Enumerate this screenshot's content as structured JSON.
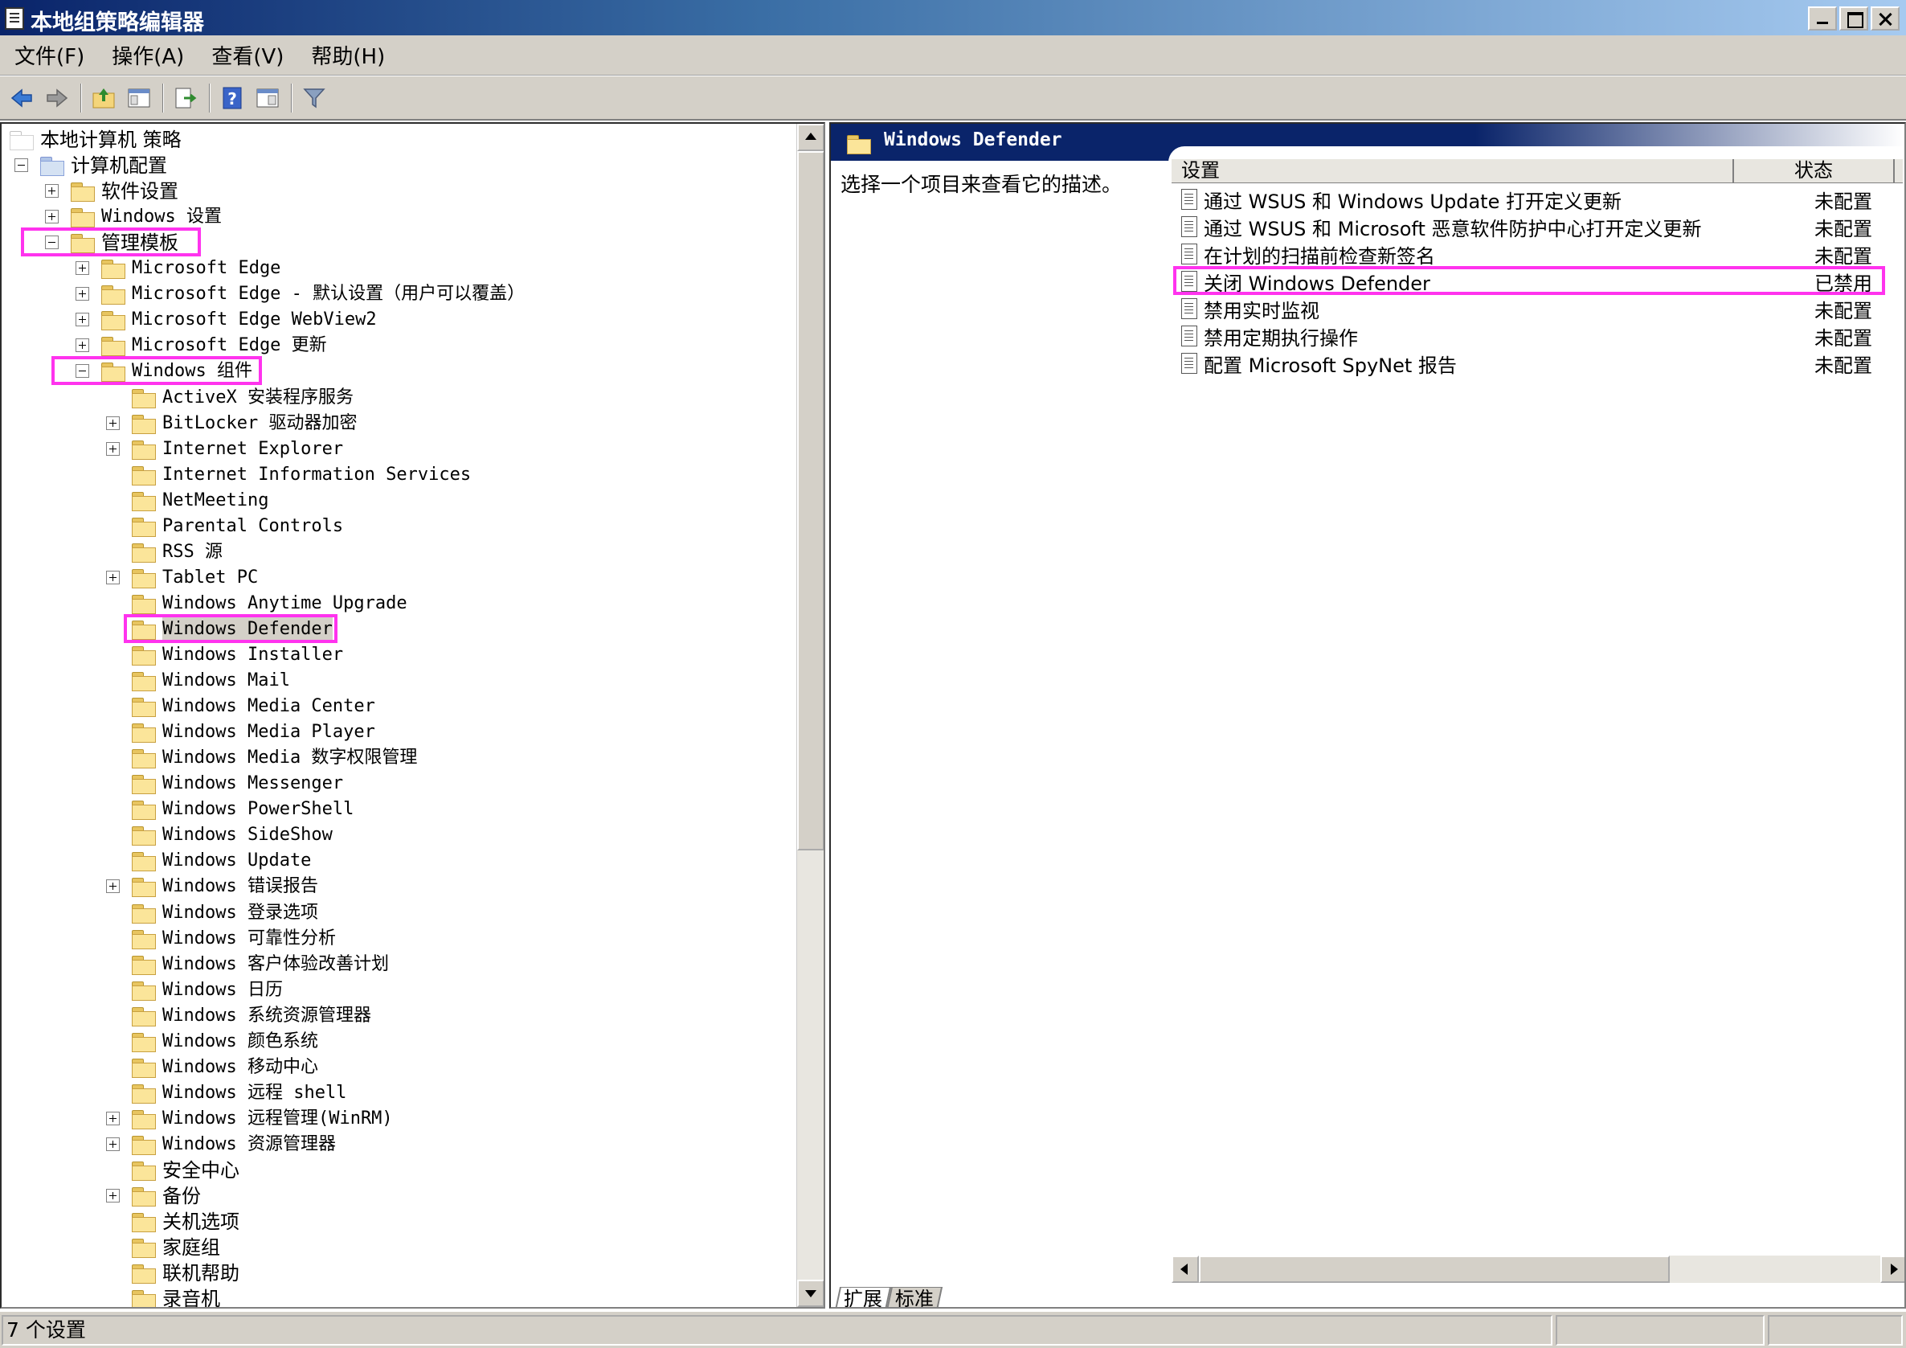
{
  "window": {
    "title": "本地组策略编辑器"
  },
  "menu": [
    "文件(F)",
    "操作(A)",
    "查看(V)",
    "帮助(H)"
  ],
  "toolbar": {
    "icons": [
      "back-arrow-icon",
      "forward-arrow-icon",
      "up-folder-icon",
      "show-hide-tree-icon",
      "export-list-icon",
      "help-icon",
      "properties-icon",
      "filter-icon"
    ]
  },
  "tree": [
    {
      "label": "本地计算机 策略",
      "level": 0,
      "expander": "none",
      "icon": "policy"
    },
    {
      "label": "计算机配置",
      "level": 1,
      "expander": "minus",
      "icon": "computer"
    },
    {
      "label": "软件设置",
      "level": 2,
      "expander": "plus",
      "icon": "folder"
    },
    {
      "label": "Windows 设置",
      "level": 2,
      "expander": "plus",
      "icon": "folder"
    },
    {
      "label": "管理模板",
      "level": 2,
      "expander": "minus",
      "icon": "folder"
    },
    {
      "label": "Microsoft Edge",
      "level": 3,
      "expander": "plus",
      "icon": "folder"
    },
    {
      "label": "Microsoft Edge - 默认设置（用户可以覆盖）",
      "level": 3,
      "expander": "plus",
      "icon": "folder"
    },
    {
      "label": "Microsoft Edge WebView2",
      "level": 3,
      "expander": "plus",
      "icon": "folder"
    },
    {
      "label": "Microsoft Edge 更新",
      "level": 3,
      "expander": "plus",
      "icon": "folder"
    },
    {
      "label": "Windows 组件",
      "level": 3,
      "expander": "minus",
      "icon": "folder"
    },
    {
      "label": "ActiveX 安装程序服务",
      "level": 4,
      "expander": "none",
      "icon": "folder"
    },
    {
      "label": "BitLocker 驱动器加密",
      "level": 4,
      "expander": "plus",
      "icon": "folder"
    },
    {
      "label": "Internet Explorer",
      "level": 4,
      "expander": "plus",
      "icon": "folder"
    },
    {
      "label": "Internet Information Services",
      "level": 4,
      "expander": "none",
      "icon": "folder"
    },
    {
      "label": "NetMeeting",
      "level": 4,
      "expander": "none",
      "icon": "folder"
    },
    {
      "label": "Parental Controls",
      "level": 4,
      "expander": "none",
      "icon": "folder"
    },
    {
      "label": "RSS 源",
      "level": 4,
      "expander": "none",
      "icon": "folder"
    },
    {
      "label": "Tablet PC",
      "level": 4,
      "expander": "plus",
      "icon": "folder"
    },
    {
      "label": "Windows Anytime Upgrade",
      "level": 4,
      "expander": "none",
      "icon": "folder"
    },
    {
      "label": "Windows Defender",
      "level": 4,
      "expander": "none",
      "icon": "folder",
      "selected": true
    },
    {
      "label": "Windows Installer",
      "level": 4,
      "expander": "none",
      "icon": "folder"
    },
    {
      "label": "Windows Mail",
      "level": 4,
      "expander": "none",
      "icon": "folder"
    },
    {
      "label": "Windows Media Center",
      "level": 4,
      "expander": "none",
      "icon": "folder"
    },
    {
      "label": "Windows Media Player",
      "level": 4,
      "expander": "none",
      "icon": "folder"
    },
    {
      "label": "Windows Media 数字权限管理",
      "level": 4,
      "expander": "none",
      "icon": "folder"
    },
    {
      "label": "Windows Messenger",
      "level": 4,
      "expander": "none",
      "icon": "folder"
    },
    {
      "label": "Windows PowerShell",
      "level": 4,
      "expander": "none",
      "icon": "folder"
    },
    {
      "label": "Windows SideShow",
      "level": 4,
      "expander": "none",
      "icon": "folder"
    },
    {
      "label": "Windows Update",
      "level": 4,
      "expander": "none",
      "icon": "folder"
    },
    {
      "label": "Windows 错误报告",
      "level": 4,
      "expander": "plus",
      "icon": "folder"
    },
    {
      "label": "Windows 登录选项",
      "level": 4,
      "expander": "none",
      "icon": "folder"
    },
    {
      "label": "Windows 可靠性分析",
      "level": 4,
      "expander": "none",
      "icon": "folder"
    },
    {
      "label": "Windows 客户体验改善计划",
      "level": 4,
      "expander": "none",
      "icon": "folder"
    },
    {
      "label": "Windows 日历",
      "level": 4,
      "expander": "none",
      "icon": "folder"
    },
    {
      "label": "Windows 系统资源管理器",
      "level": 4,
      "expander": "none",
      "icon": "folder"
    },
    {
      "label": "Windows 颜色系统",
      "level": 4,
      "expander": "none",
      "icon": "folder"
    },
    {
      "label": "Windows 移动中心",
      "level": 4,
      "expander": "none",
      "icon": "folder"
    },
    {
      "label": "Windows 远程 shell",
      "level": 4,
      "expander": "none",
      "icon": "folder"
    },
    {
      "label": "Windows 远程管理(WinRM)",
      "level": 4,
      "expander": "plus",
      "icon": "folder"
    },
    {
      "label": "Windows 资源管理器",
      "level": 4,
      "expander": "plus",
      "icon": "folder"
    },
    {
      "label": "安全中心",
      "level": 4,
      "expander": "none",
      "icon": "folder"
    },
    {
      "label": "备份",
      "level": 4,
      "expander": "plus",
      "icon": "folder"
    },
    {
      "label": "关机选项",
      "level": 4,
      "expander": "none",
      "icon": "folder"
    },
    {
      "label": "家庭组",
      "level": 4,
      "expander": "none",
      "icon": "folder"
    },
    {
      "label": "联机帮助",
      "level": 4,
      "expander": "none",
      "icon": "folder"
    },
    {
      "label": "录音机",
      "level": 4,
      "expander": "none",
      "icon": "folder"
    }
  ],
  "details": {
    "header_title": "Windows Defender",
    "description": "选择一个项目来查看它的描述。",
    "columns": {
      "setting": "设置",
      "state": "状态"
    },
    "rows": [
      {
        "setting": "通过 WSUS 和 Windows Update 打开定义更新",
        "state": "未配置"
      },
      {
        "setting": "通过 WSUS 和 Microsoft 恶意软件防护中心打开定义更新",
        "state": "未配置"
      },
      {
        "setting": "在计划的扫描前检查新签名",
        "state": "未配置"
      },
      {
        "setting": "关闭 Windows Defender",
        "state": "已禁用",
        "highlighted": true
      },
      {
        "setting": "禁用实时监视",
        "state": "未配置"
      },
      {
        "setting": "禁用定期执行操作",
        "state": "未配置"
      },
      {
        "setting": "配置 Microsoft SpyNet 报告",
        "state": "未配置"
      }
    ]
  },
  "tabs": [
    "扩展",
    "标准"
  ],
  "status": {
    "text": "7 个设置"
  },
  "colors": {
    "highlight": "#ff33ee",
    "title_gradient_start": "#0a246a",
    "chrome": "#d4d0c8"
  }
}
